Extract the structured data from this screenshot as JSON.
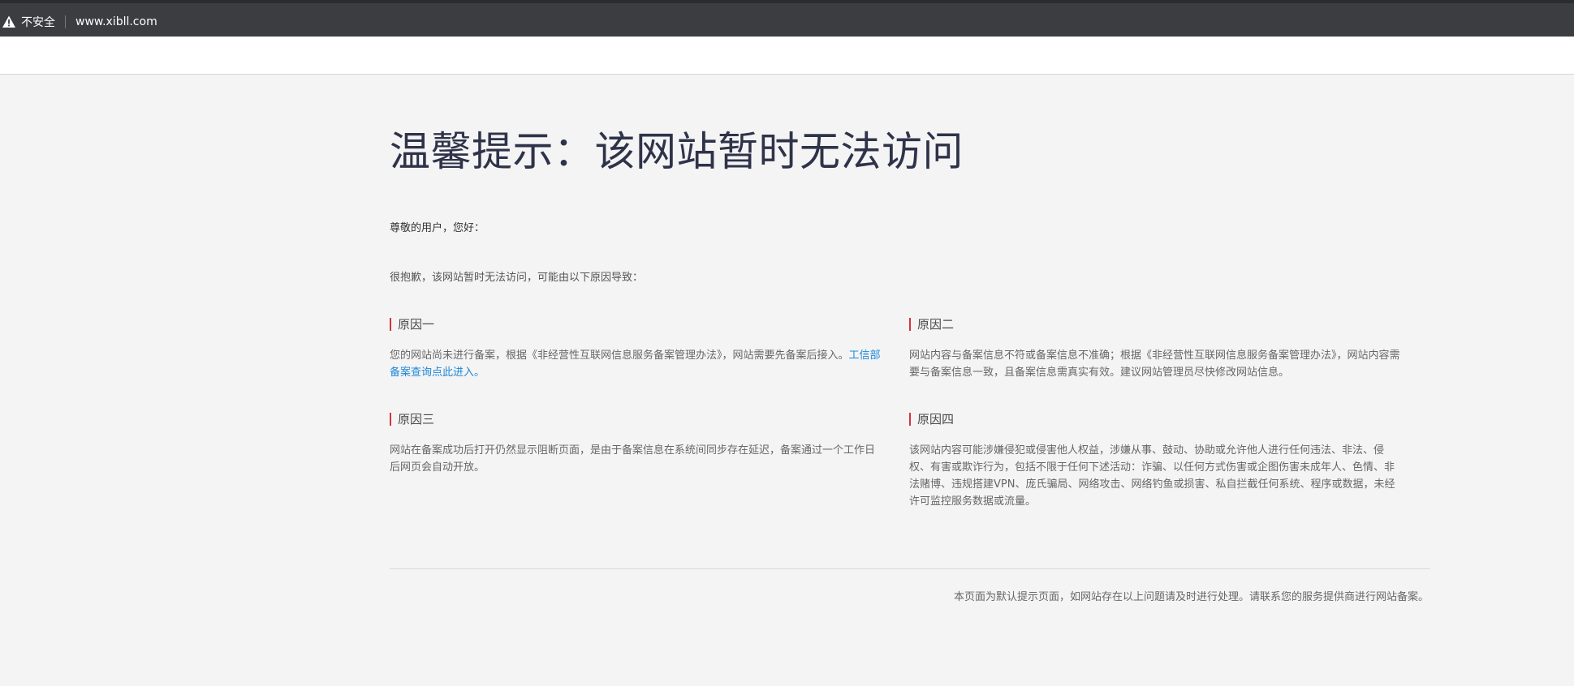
{
  "browser": {
    "security_label": "不安全",
    "url": "www.xibll.com"
  },
  "page": {
    "title": "温馨提示：该网站暂时无法访问",
    "greeting": "尊敬的用户，您好：",
    "intro": "很抱歉，该网站暂时无法访问，可能由以下原因导致：",
    "reasons": [
      {
        "heading": "原因一",
        "body": "您的网站尚未进行备案，根据《非经营性互联网信息服务备案管理办法》，网站需要先备案后接入。",
        "link": "工信部备案查询点此进入。"
      },
      {
        "heading": "原因二",
        "body": "网站内容与备案信息不符或备案信息不准确；根据《非经营性互联网信息服务备案管理办法》，网站内容需要与备案信息一致，且备案信息需真实有效。建议网站管理员尽快修改网站信息。"
      },
      {
        "heading": "原因三",
        "body": "网站在备案成功后打开仍然显示阻断页面，是由于备案信息在系统间同步存在延迟，备案通过一个工作日后网页会自动开放。"
      },
      {
        "heading": "原因四",
        "body": "该网站内容可能涉嫌侵犯或侵害他人权益，涉嫌从事、鼓动、协助或允许他人进行任何违法、非法、侵权、有害或欺诈行为，包括不限于任何下述活动：诈骗、以任何方式伤害或企图伤害未成年人、色情、非法赌博、违规搭建VPN、庞氏骗局、网络攻击、网络钓鱼或损害、私自拦截任何系统、程序或数据，未经许可监控服务数据或流量。"
      }
    ],
    "footer": "本页面为默认提示页面，如网站存在以上问题请及时进行处理。请联系您的服务提供商进行网站备案。"
  },
  "colors": {
    "accent_red": "#d2353c",
    "link_blue": "#1e88d6",
    "title_color": "#2f3349",
    "browser_bar": "#3c3d40"
  },
  "icons": {
    "security": "warning-triangle-icon"
  }
}
